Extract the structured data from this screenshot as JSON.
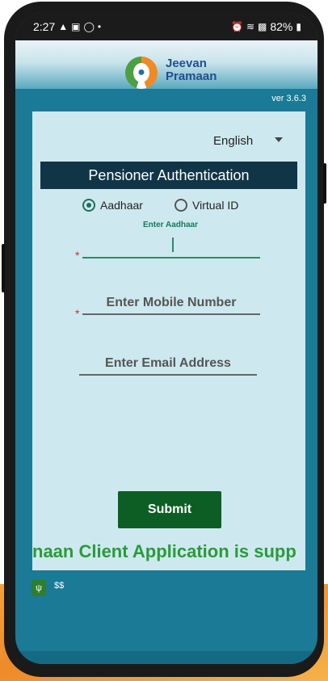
{
  "status_bar": {
    "time": "2:27",
    "battery": "82%"
  },
  "header": {
    "brand_line1": "Jeevan",
    "brand_line2": "Pramaan",
    "version": "ver 3.6.3"
  },
  "form": {
    "language": "English",
    "title": "Pensioner Authentication",
    "radio_aadhaar": "Aadhaar",
    "radio_virtual": "Virtual ID",
    "aadhaar_hint": "Enter Aadhaar",
    "required_mark": "*",
    "mobile_placeholder": "Enter Mobile Number",
    "email_placeholder": "Enter Email Address",
    "submit_label": "Submit",
    "marquee_text": "naan Client Application is supp"
  },
  "bottom": {
    "usb_icon": "usb-icon",
    "dollar_text": "$$"
  },
  "colors": {
    "screen_bg": "#1b7a95",
    "card_bg": "#cde9ef",
    "title_bar": "#103546",
    "submit_bg": "#0d5e24",
    "marquee": "#2b9a3a",
    "accent_green": "#1e6f5a"
  }
}
